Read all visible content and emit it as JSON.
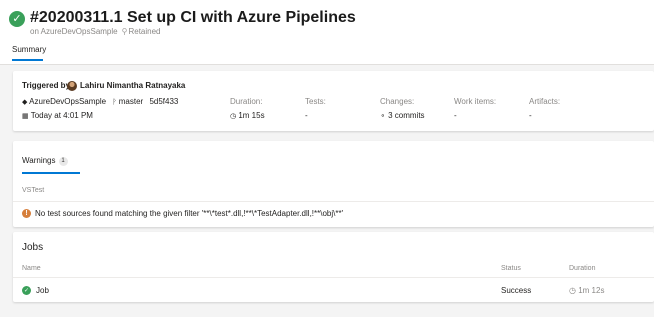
{
  "header": {
    "title": "#20200311.1 Set up CI with Azure Pipelines",
    "repo_prefix": "on AzureDevOpsSample",
    "retained": "Retained",
    "tab_summary": "Summary"
  },
  "summary": {
    "triggered_by_label": "Triggered by",
    "triggered_by_user": "Lahiru Nimantha Ratnayaka",
    "repo": "AzureDevOpsSample",
    "branch": "master",
    "commit": "5d5f433",
    "time": "Today at 4:01 PM",
    "duration_label": "Duration:",
    "duration_value": "1m 15s",
    "tests_label": "Tests:",
    "tests_value": "-",
    "changes_label": "Changes:",
    "changes_value": "3 commits",
    "work_items_label": "Work items:",
    "work_items_value": "-",
    "artifacts_label": "Artifacts:",
    "artifacts_value": "-"
  },
  "warnings": {
    "tab_label": "Warnings",
    "count": "1",
    "section": "VSTest",
    "message": "No test sources found matching the given filter '**\\*test*.dll,!**\\*TestAdapter.dll,!**\\obj\\**'"
  },
  "jobs": {
    "title": "Jobs",
    "col_name": "Name",
    "col_status": "Status",
    "col_duration": "Duration",
    "rows": [
      {
        "name": "Job",
        "status": "Success",
        "duration": "1m 12s"
      }
    ]
  },
  "colors": {
    "accent": "#0078d4",
    "success": "#3aa05a",
    "warning": "#d67f3c"
  },
  "icons": {
    "status": "check-circle-icon",
    "retained": "pin-icon",
    "repo": "repo-icon",
    "branch": "branch-icon",
    "calendar": "calendar-icon",
    "clock": "clock-icon",
    "commit": "commit-icon",
    "warning": "warning-icon"
  }
}
